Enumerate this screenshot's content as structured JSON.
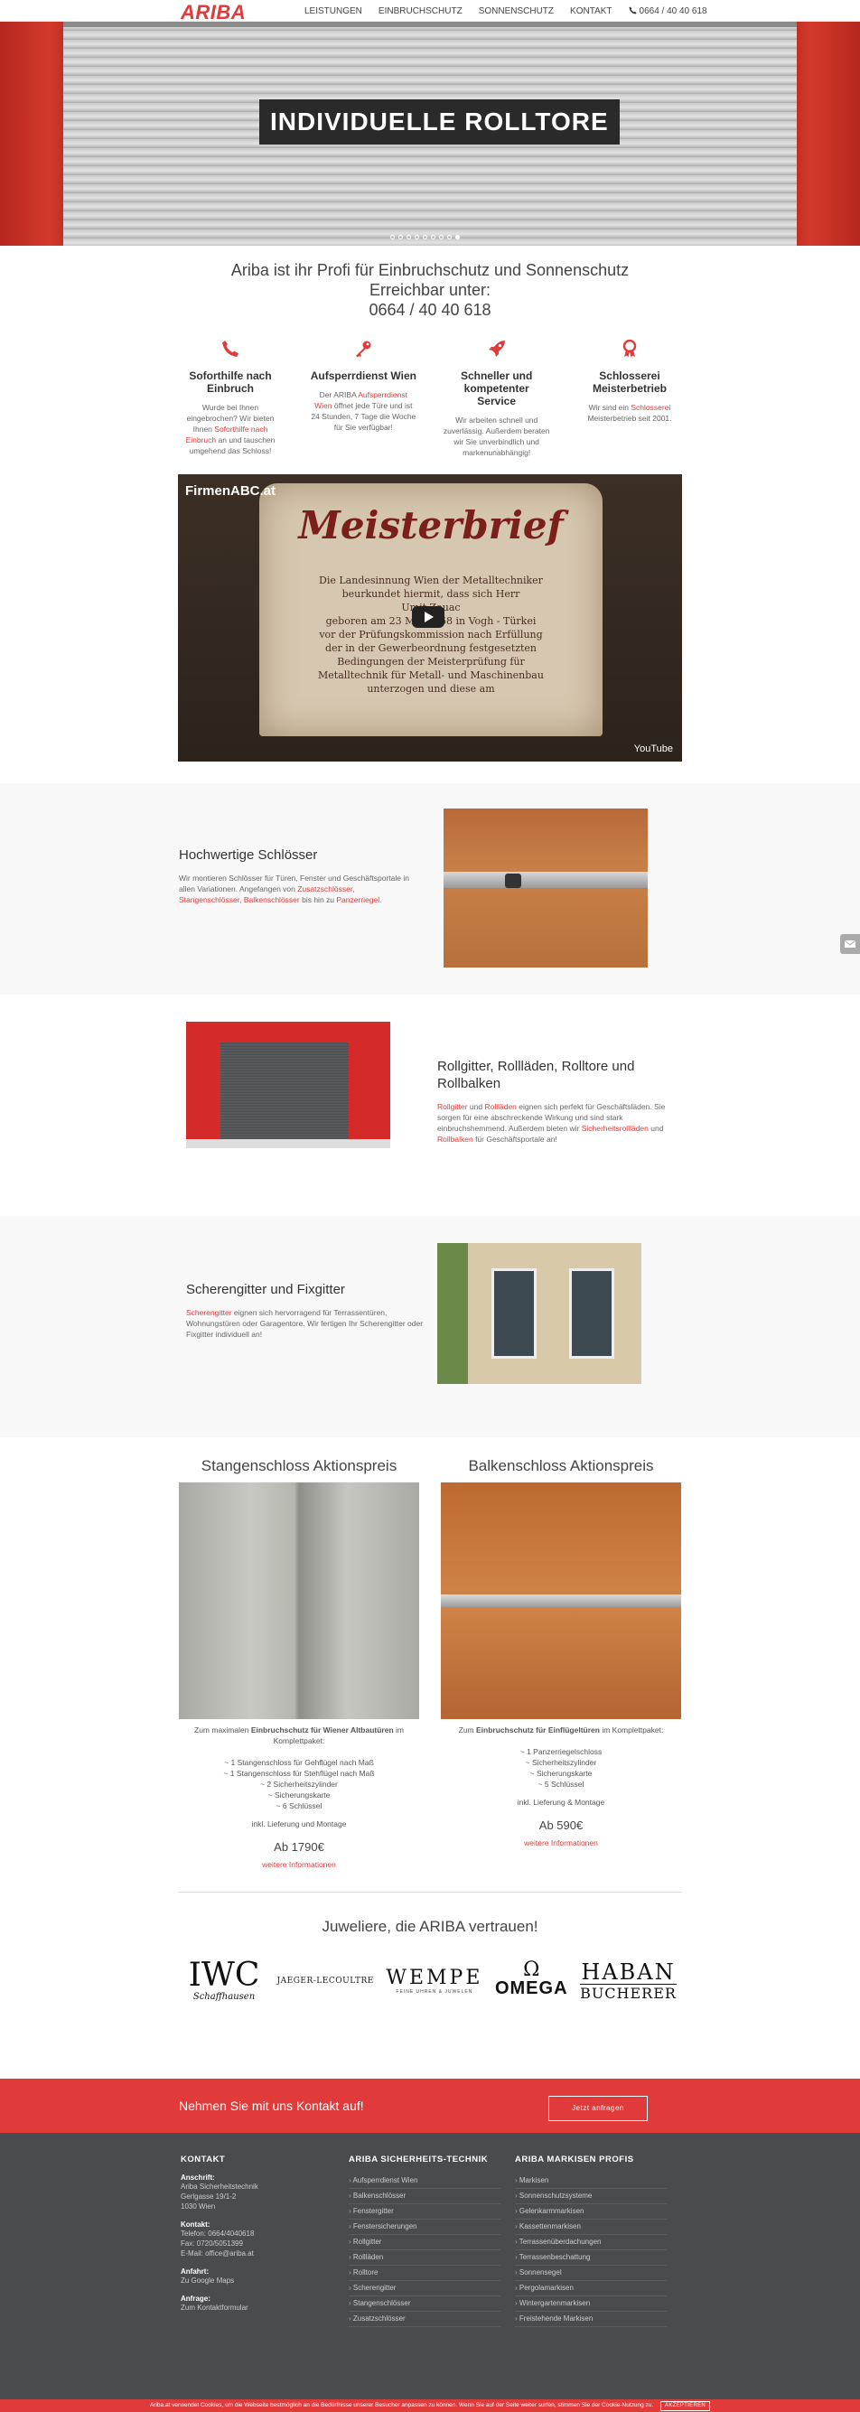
{
  "header": {
    "logo": "ARIBA",
    "nav": [
      "LEISTUNGEN",
      "EINBRUCHSCHUTZ",
      "SONNENSCHUTZ",
      "KONTAKT"
    ],
    "phone": "0664 / 40 40 618"
  },
  "hero": {
    "title": "INDIVIDUELLE ROLLTORE",
    "slide_count": 9,
    "active_slide": 8
  },
  "intro": {
    "title_line1": "Ariba ist ihr Profi für Einbruchschutz und Sonnenschutz",
    "title_line2": "Erreichbar unter:",
    "phone": "0664 / 40 40 618"
  },
  "features": [
    {
      "icon": "phone-icon",
      "title": "Soforthilfe nach Einbruch",
      "text_a": "Wurde bei Ihnen eingebrochen? Wir bieten Ihnen ",
      "link": "Soforthilfe nach Einbruch",
      "text_b": " an und tauschen umgehend das Schloss!"
    },
    {
      "icon": "key-icon",
      "title": "Aufsperrdienst Wien",
      "text_a": "Der ARIBA ",
      "link": "Aufsperrdienst Wien",
      "text_b": " öffnet jede Türe und ist 24 Stunden, 7 Tage die Woche für Sie verfügbar!"
    },
    {
      "icon": "rocket-icon",
      "title": "Schneller und kompetenter Service",
      "text_a": "Wir arbeiten schnell und zuverlässig. Außerdem beraten wir Sie unverbindlich und markenunabhängig!",
      "link": "",
      "text_b": ""
    },
    {
      "icon": "award-icon",
      "title": "Schlosserei Meisterbetrieb",
      "text_a": "Wir sind ein ",
      "link": "Schlosserei",
      "text_b": " Meisterbetrieb seit 2001."
    }
  ],
  "video": {
    "channel": "FirmenABC.at",
    "heading": "Meisterbrief",
    "lines": [
      "Die Landesinnung Wien der Metalltechniker",
      "beurkundet hiermit, dass sich Herr",
      "Umit Zauac",
      "geboren am 23 Mai 1968 in Vogh - Türkei",
      "vor der Prüfungskommission nach Erfüllung",
      "der in der Gewerbeordnung festgesetzten",
      "Bedingungen der Meisterprüfung für",
      "Metalltechnik für Metall- und Maschinenbau",
      "unterzogen und diese am"
    ],
    "yt_label": "YouTube"
  },
  "sections": {
    "schloesser": {
      "title": "Hochwertige Schlösser",
      "t1": "Wir montieren Schlösser für Türen, Fenster und Geschäftsportale in allen Variationen. Angefangen von ",
      "l1": "Zusatzschlösser",
      "t2": ", ",
      "l2": "Stangenschlösser",
      "t3": ", ",
      "l3": "Balkenschlösser",
      "t4": " bis hin zu ",
      "l4": "Panzerriegel",
      "t5": "."
    },
    "rollgitter": {
      "title": "Rollgitter, Rollläden, Rolltore und Rollbalken",
      "l1": "Rollgitter",
      "t1": " und ",
      "l2": "Rollläden",
      "t2": " eignen sich perfekt für Geschäftsläden. Sie sorgen für eine abschreckende Wirkung und sind stark einbruchshemmend. Außerdem bieten wir ",
      "l3": "Sicherheitsrollläden",
      "t3": " und ",
      "l4": "Rollbalken",
      "t4": " für Geschäftsportale an!"
    },
    "scheren": {
      "title": "Scherengitter und Fixgitter",
      "l1": "Scherengitter",
      "t1": " eignen sich hervorragend für Terrassentüren, Wohnungstüren oder Garagentore. Wir fertigen Ihr Scherengitter oder Fixgitter individuell an!"
    }
  },
  "products": [
    {
      "title": "Stangenschloss Aktionspreis",
      "intro_a": "Zum maximalen ",
      "intro_b": "Einbruchschutz für Wiener Altbautüren",
      "intro_c": " im Komplettpaket:",
      "items": [
        "~ 1 Stangenschloss für Gehflügel nach Maß",
        "~ 1 Stangenschloss für Stehflügel nach Maß",
        "~ 2 Sicherheitszylinder",
        "~ Sicherungskarte",
        "~ 6 Schlüssel"
      ],
      "note": "inkl. Lieferung und Montage",
      "price": "Ab 1790€",
      "more": "weitere Informationen"
    },
    {
      "title": "Balkenschloss Aktionspreis",
      "intro_a": "Zum ",
      "intro_b": "Einbruchschutz für Einflügeltüren",
      "intro_c": " im Komplettpaket:",
      "items": [
        "~ 1 Panzerriegelschloss",
        "~ Sicherheitszylinder",
        "~ Sicherungskarte",
        "~ 5 Schlüssel"
      ],
      "note": "inkl. Lieferung & Montage",
      "price": "Ab 590€",
      "more": "weitere Informationen"
    }
  ],
  "jewelers": {
    "title": "Juweliere, die ARIBA vertrauen!",
    "brands": [
      {
        "main": "IWC",
        "sub": "Schaffhausen"
      },
      {
        "main": "JAEGER-LECOULTRE",
        "sub": ""
      },
      {
        "main": "WEMPE",
        "sub": "FEINE UHREN & JUWELEN"
      },
      {
        "main": "OMEGA",
        "sub": "Ω"
      },
      {
        "main": "HABAN",
        "sub": "BUCHERER"
      }
    ]
  },
  "cta": {
    "text": "Nehmen Sie mit uns Kontakt auf!",
    "button": "Jetzt anfragen"
  },
  "footer": {
    "kontakt_title": "KONTAKT",
    "anschrift_label": "Anschrift:",
    "anschrift": [
      "Ariba Sicherheitstechnik",
      "Gerlgasse 19/1-2",
      "1030 Wien"
    ],
    "kontakt_label": "Kontakt:",
    "kontakt": [
      "Telefon: 0664/4040618",
      "Fax: 0720/5051399",
      "E-Mail: office@ariba.at"
    ],
    "anfahrt_label": "Anfahrt:",
    "anfahrt": "Zu Google Maps",
    "anfrage_label": "Anfrage:",
    "anfrage": "Zum Kontaktformular",
    "col2_title": "ARIBA SICHERHEITS-TECHNIK",
    "col2": [
      "Aufsperrdienst Wien",
      "Balkenschlösser",
      "Fenstergitter",
      "Fenstersicherungen",
      "Rollgitter",
      "Rollläden",
      "Rolltore",
      "Scherengitter",
      "Stangenschlösser",
      "Zusatzschlösser"
    ],
    "col3_title": "ARIBA MARKISEN PROFIS",
    "col3": [
      "Markisen",
      "Sonnenschutzsysteme",
      "Gelenkarmmarkisen",
      "Kassettenmarkisen",
      "Terrassenüberdachungen",
      "Terrassenbeschattung",
      "Sonnensegel",
      "Pergolamarkisen",
      "Wintergartenmarkisen",
      "Freistehende Markisen"
    ]
  },
  "cookie": {
    "text": "Ariba.at verwendet Cookies, um die Webseite bestmöglich an die Bedürfnisse unserer Besucher anpassen zu können. Wenn Sie auf der Seite weiter surfen, stimmen Sie der Cookie-Nutzung zu.",
    "accept": "AKZEPTIEREN"
  },
  "colors": {
    "accent": "#e03a3a",
    "footer_bg": "#4a4b4f",
    "section_gray": "#f8f8f8"
  }
}
